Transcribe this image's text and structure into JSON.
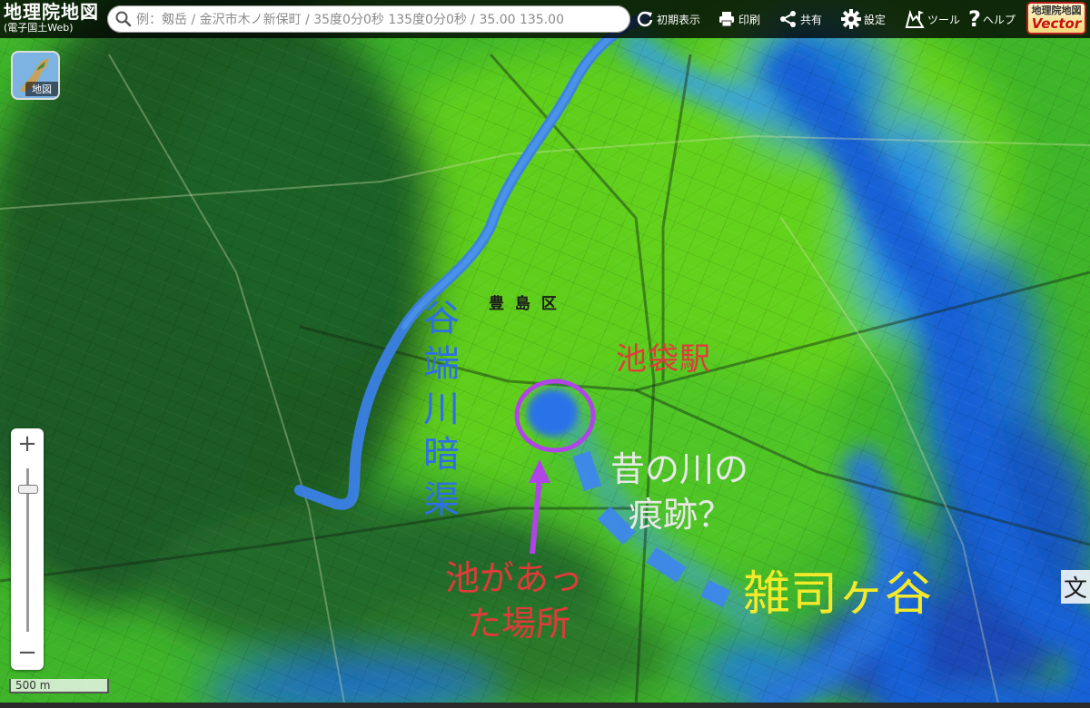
{
  "app": {
    "brand_title": "地理院地図",
    "brand_sub": "(電子国土Web)"
  },
  "search": {
    "placeholder": "例：剱岳 / 金沢市木ノ新保町 / 35度0分0秒 135度0分0秒 / 35.00 135.00"
  },
  "toolbar": {
    "initial_view": "初期表示",
    "print": "印刷",
    "share": "共有",
    "settings": "設定",
    "tools": "ツール",
    "help": "ヘルプ",
    "vector_top": "地理院地図",
    "vector_bottom": "Vector"
  },
  "layer_button": {
    "label": "地図"
  },
  "zoom": {
    "plus": "+",
    "minus": "−",
    "level_fraction": 0.12
  },
  "scale_bar": {
    "label": "500 m"
  },
  "map": {
    "ward_label": "豊 島 区",
    "annotations": {
      "river_name": "谷端川暗渠",
      "station": "池袋駅",
      "old_river": [
        "昔の川の",
        "痕跡？"
      ],
      "pond_site": [
        "池があっ",
        "た場所"
      ],
      "valley": "雑司ヶ谷",
      "partial_edge": "文"
    },
    "colors": {
      "river_line": "#3b7fe6",
      "pond_circle": "#b044e6",
      "arrow": "#b044e6",
      "station_text": "#e23a3a",
      "river_text": "#2d6fe8",
      "old_river_text": "#e8e8e8",
      "pond_text": "#e23a3a",
      "valley_text": "#f2ea2a"
    }
  }
}
